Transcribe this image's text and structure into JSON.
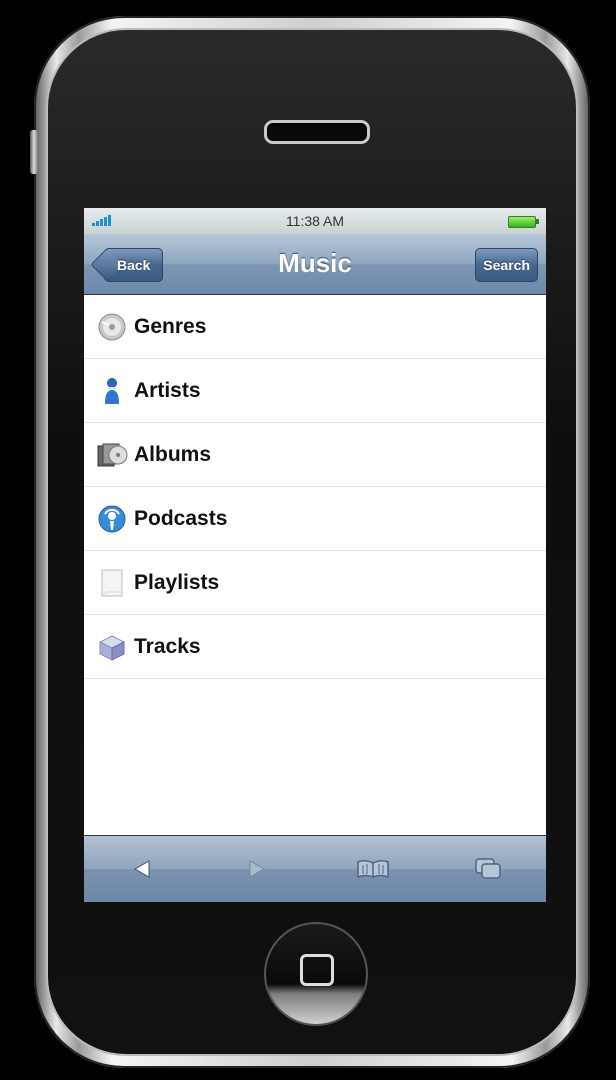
{
  "status": {
    "time": "11:38 AM"
  },
  "nav": {
    "title": "Music",
    "back_label": "Back",
    "search_label": "Search"
  },
  "list": {
    "items": [
      {
        "label": "Genres",
        "icon": "disc-icon"
      },
      {
        "label": "Artists",
        "icon": "artist-icon"
      },
      {
        "label": "Albums",
        "icon": "album-icon"
      },
      {
        "label": "Podcasts",
        "icon": "podcast-icon"
      },
      {
        "label": "Playlists",
        "icon": "playlist-icon"
      },
      {
        "label": "Tracks",
        "icon": "track-icon"
      }
    ]
  },
  "toolbar": {
    "items": [
      "back-arrow-icon",
      "forward-arrow-icon",
      "bookmarks-icon",
      "pages-icon"
    ]
  },
  "colors": {
    "nav_bar": "#7c96b4",
    "button": "#48678f",
    "background": "#000000"
  }
}
